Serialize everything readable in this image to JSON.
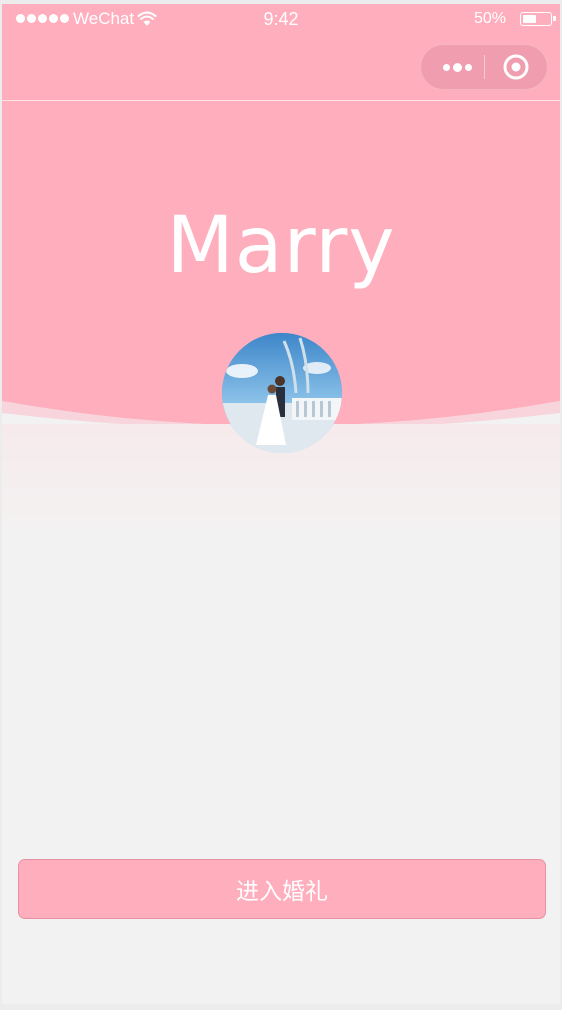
{
  "status_bar": {
    "carrier": "WeChat",
    "time": "9:42",
    "battery": "50%",
    "signal_icon": "signal-dots-icon",
    "wifi_icon": "wifi-icon",
    "battery_icon": "battery-icon",
    "battery_level": 0.5
  },
  "nav_bar": {
    "more_icon": "more-dots-icon",
    "close_icon": "target-circle-icon"
  },
  "hero": {
    "title": "Marry",
    "avatar_icon": "wedding-couple-photo"
  },
  "actions": {
    "enter_label": "进入婚礼"
  },
  "colors": {
    "primary": "#ffaebd",
    "background": "#f3f2f2",
    "text_on_primary": "#ffffff"
  }
}
